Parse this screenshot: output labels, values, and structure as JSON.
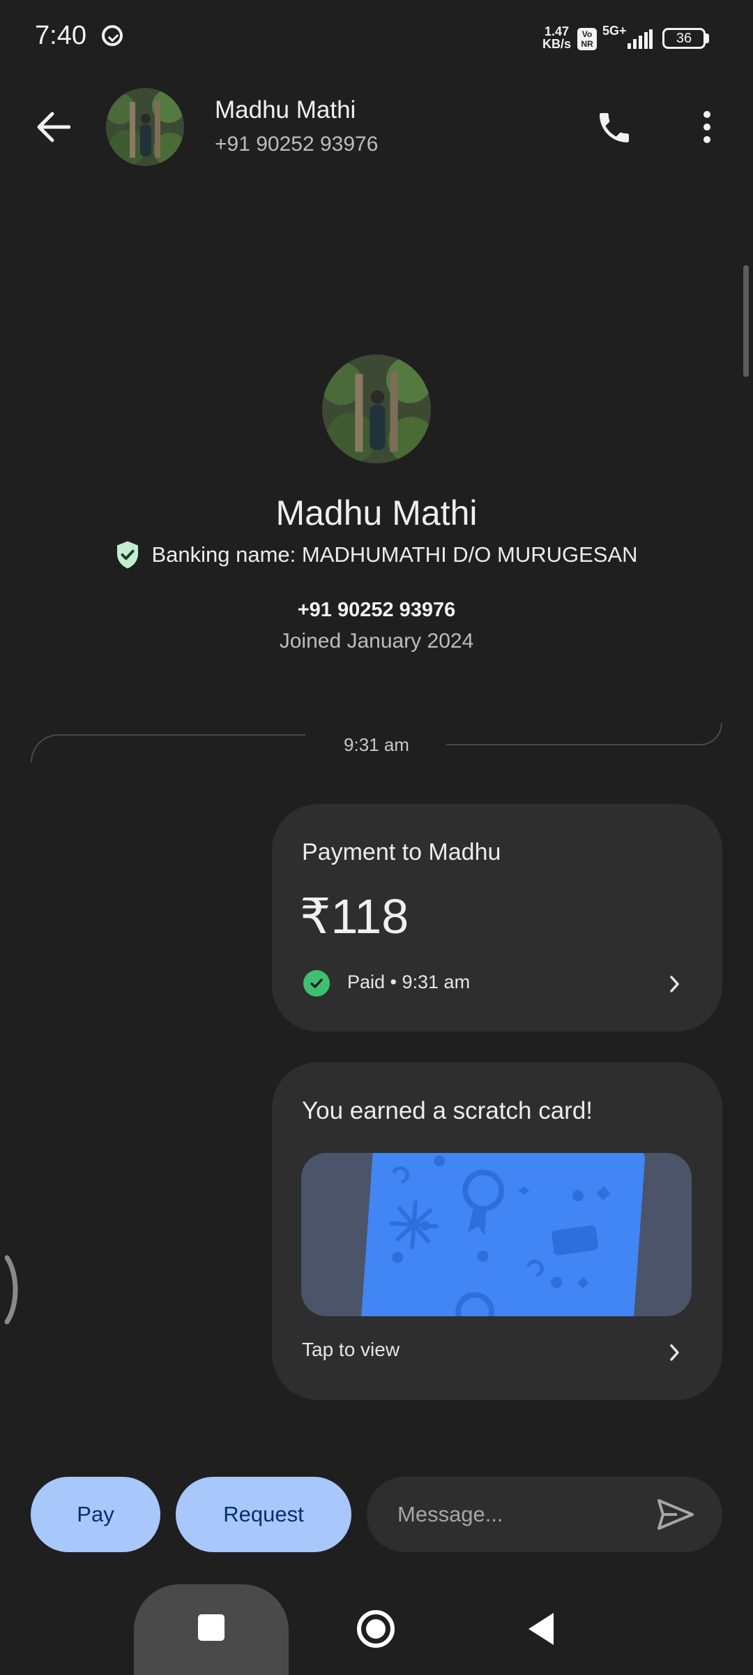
{
  "status_bar": {
    "time": "7:40",
    "net_speed_value": "1.47",
    "net_speed_unit": "KB/s",
    "volte": "Vo NR",
    "network": "5G+",
    "battery": "36",
    "icons": [
      "app-notification-icon",
      "volte-icon",
      "signal-icon",
      "battery-icon"
    ]
  },
  "header": {
    "name": "Madhu Mathi",
    "phone": "+91 90252 93976",
    "icons": [
      "back-arrow-icon",
      "phone-icon",
      "more-vert-icon"
    ]
  },
  "profile": {
    "name": "Madhu Mathi",
    "banking_name": "Banking name: MADHUMATHI D/O MURUGESAN",
    "phone": "+91 90252 93976",
    "joined": "Joined January 2024"
  },
  "timeline": {
    "time": "9:31 am"
  },
  "payment_card": {
    "title": "Payment to Madhu",
    "amount": "₹118",
    "status": "Paid • 9:31 am"
  },
  "scratch_card": {
    "title": "You earned a scratch card!",
    "action": "Tap to view"
  },
  "compose": {
    "pay_label": "Pay",
    "request_label": "Request",
    "message_placeholder": "Message..."
  },
  "colors": {
    "background": "#1f1f1f",
    "card": "#2e2e2e",
    "button": "#a8c7fa",
    "button_text": "#062e6f",
    "paid_green": "#3ebf72",
    "verified_green": "#c4eed0",
    "scratch_blue": "#4285f4"
  }
}
